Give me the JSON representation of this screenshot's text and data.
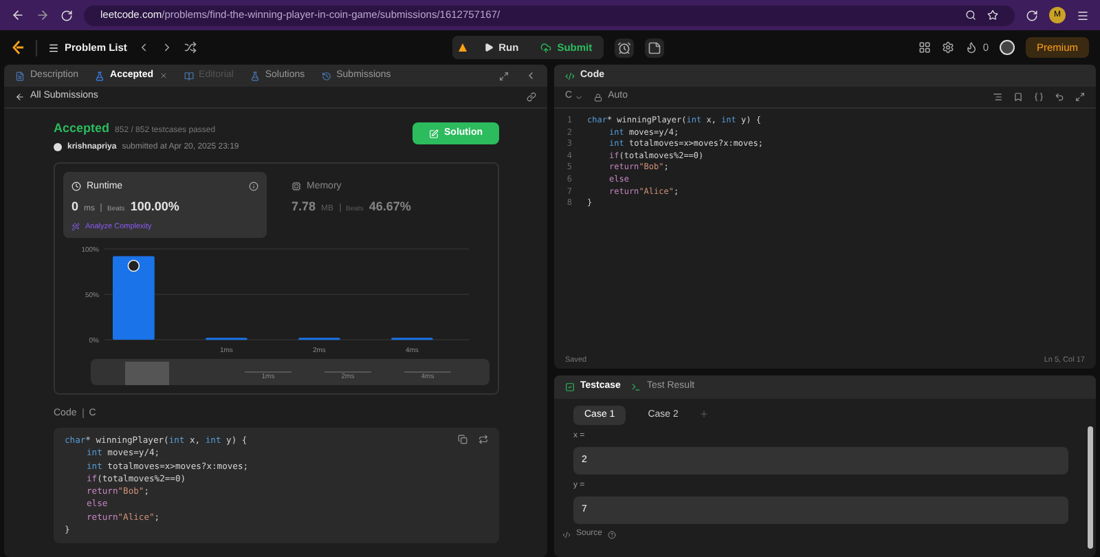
{
  "browser": {
    "domain": "leetcode.com",
    "path": "/problems/find-the-winning-player-in-coin-game/submissions/1612757167/",
    "avatar": "M"
  },
  "nav": {
    "problem_list": "Problem List",
    "run": "Run",
    "submit": "Submit",
    "streak": "0",
    "premium": "Premium"
  },
  "left_tabs": [
    {
      "label": "Description",
      "selected": false,
      "disabled": false
    },
    {
      "label": "Accepted",
      "selected": true,
      "disabled": false
    },
    {
      "label": "Editorial",
      "selected": false,
      "disabled": true
    },
    {
      "label": "Solutions",
      "selected": false,
      "disabled": false
    },
    {
      "label": "Submissions",
      "selected": false,
      "disabled": false
    }
  ],
  "back_link": "All Submissions",
  "result": {
    "status": "Accepted",
    "passed": "852 / 852 testcases passed",
    "user": "krishnapriya",
    "submitted": "submitted at Apr 20, 2025 23:19",
    "solution_button": "Solution"
  },
  "metrics": [
    {
      "title": "Runtime",
      "value": "0",
      "unit": "ms",
      "beats_label": "Beats",
      "beats": "100.00%",
      "selected": true
    },
    {
      "title": "Memory",
      "value": "7.78",
      "unit": "MB",
      "beats_label": "Beats",
      "beats": "46.67%",
      "selected": false
    }
  ],
  "analyze": "Analyze Complexity",
  "chart_data": {
    "type": "bar",
    "categories": [
      null,
      "1ms",
      "2ms",
      "4ms"
    ],
    "values": [
      92,
      2,
      2,
      2
    ],
    "ylim": [
      0,
      100
    ],
    "yticks": [
      {
        "value": 0,
        "label": "0%"
      },
      {
        "value": 50,
        "label": "50%"
      },
      {
        "value": 100,
        "label": "100%"
      }
    ]
  },
  "navigator_labels": [
    "1ms",
    "2ms",
    "4ms"
  ],
  "code_label": "Code",
  "code_lang": "C",
  "submitted_code": [
    {
      "indented": false,
      "tokens": [
        {
          "kind": "keyword",
          "text": "char"
        },
        {
          "kind": "plain",
          "text": "* winningPlayer("
        },
        {
          "kind": "keyword",
          "text": "int"
        },
        {
          "kind": "plain",
          "text": " x, "
        },
        {
          "kind": "keyword",
          "text": "int"
        },
        {
          "kind": "plain",
          "text": " y) {"
        }
      ]
    },
    {
      "indented": true,
      "tokens": [
        {
          "kind": "keyword",
          "text": "int"
        },
        {
          "kind": "plain",
          "text": " moves=y/4;"
        }
      ]
    },
    {
      "indented": true,
      "tokens": [
        {
          "kind": "keyword",
          "text": "int"
        },
        {
          "kind": "plain",
          "text": " totalmoves=x>moves?x:moves;"
        }
      ]
    },
    {
      "indented": true,
      "tokens": [
        {
          "kind": "control",
          "text": "if"
        },
        {
          "kind": "plain",
          "text": "(totalmoves%2==0)"
        }
      ]
    },
    {
      "indented": true,
      "tokens": [
        {
          "kind": "control",
          "text": "return"
        },
        {
          "kind": "string",
          "text": "\"Bob\""
        },
        {
          "kind": "plain",
          "text": ";"
        }
      ]
    },
    {
      "indented": true,
      "tokens": [
        {
          "kind": "control",
          "text": "else"
        }
      ]
    },
    {
      "indented": true,
      "tokens": [
        {
          "kind": "control",
          "text": "return"
        },
        {
          "kind": "string",
          "text": "\"Alice\""
        },
        {
          "kind": "plain",
          "text": ";"
        }
      ]
    },
    {
      "indented": false,
      "tokens": [
        {
          "kind": "plain",
          "text": "}"
        }
      ]
    }
  ],
  "editor": {
    "title": "Code",
    "language": "C",
    "mode": "Auto",
    "status": "Saved",
    "cursor": "Ln 5, Col 17",
    "lines": [
      {
        "number": "1",
        "indented": false,
        "tokens": [
          {
            "kind": "keyword",
            "text": "char"
          },
          {
            "kind": "plain",
            "text": "* winningPlayer("
          },
          {
            "kind": "keyword",
            "text": "int"
          },
          {
            "kind": "plain",
            "text": " x, "
          },
          {
            "kind": "keyword",
            "text": "int"
          },
          {
            "kind": "plain",
            "text": " y) {"
          }
        ]
      },
      {
        "number": "2",
        "indented": true,
        "tokens": [
          {
            "kind": "keyword",
            "text": "int"
          },
          {
            "kind": "plain",
            "text": " moves=y/4;"
          }
        ]
      },
      {
        "number": "3",
        "indented": true,
        "tokens": [
          {
            "kind": "keyword",
            "text": "int"
          },
          {
            "kind": "plain",
            "text": " totalmoves=x>moves?x:moves;"
          }
        ]
      },
      {
        "number": "4",
        "indented": true,
        "tokens": [
          {
            "kind": "control",
            "text": "if"
          },
          {
            "kind": "plain",
            "text": "(totalmoves%2==0)"
          }
        ]
      },
      {
        "number": "5",
        "indented": true,
        "tokens": [
          {
            "kind": "control",
            "text": "return"
          },
          {
            "kind": "string",
            "text": "\"Bob\""
          },
          {
            "kind": "plain",
            "text": ";"
          }
        ]
      },
      {
        "number": "6",
        "indented": true,
        "tokens": [
          {
            "kind": "control",
            "text": "else"
          }
        ]
      },
      {
        "number": "7",
        "indented": true,
        "tokens": [
          {
            "kind": "control",
            "text": "return"
          },
          {
            "kind": "string",
            "text": "\"Alice\""
          },
          {
            "kind": "plain",
            "text": ";"
          }
        ]
      },
      {
        "number": "8",
        "indented": false,
        "tokens": [
          {
            "kind": "plain",
            "text": "}"
          }
        ]
      }
    ]
  },
  "testcase": {
    "tabs": [
      {
        "label": "Testcase",
        "selected": true
      },
      {
        "label": "Test Result",
        "selected": false
      }
    ],
    "cases": [
      {
        "label": "Case 1",
        "selected": true
      },
      {
        "label": "Case 2",
        "selected": false
      }
    ],
    "add": "+",
    "params": [
      {
        "name": "x =",
        "value": "2"
      },
      {
        "name": "y =",
        "value": "7"
      }
    ],
    "source": "Source"
  }
}
